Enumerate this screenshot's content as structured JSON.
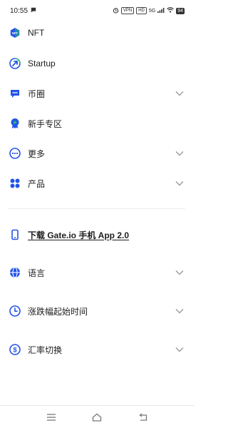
{
  "status_bar": {
    "time": "10:55",
    "badge1": "VPN",
    "badge2": "HD",
    "network": "5G",
    "battery": "94"
  },
  "menu": {
    "items": [
      {
        "id": "nft",
        "label": "NFT",
        "icon": "nft-icon",
        "expandable": false
      },
      {
        "id": "startup",
        "label": "Startup",
        "icon": "startup-arrow-icon",
        "expandable": false
      },
      {
        "id": "bi-quan",
        "label": "币圈",
        "icon": "chat-bubble-icon",
        "expandable": true
      },
      {
        "id": "novice",
        "label": "新手专区",
        "icon": "badge-star-icon",
        "expandable": false
      },
      {
        "id": "more",
        "label": "更多",
        "icon": "more-dots-icon",
        "expandable": true
      },
      {
        "id": "products",
        "label": "产品",
        "icon": "grid-dots-icon",
        "expandable": true
      }
    ],
    "download": {
      "label": "下载 Gate.io 手机 App 2.0",
      "icon": "phone-icon"
    },
    "settings": [
      {
        "id": "language",
        "label": "语言",
        "icon": "globe-icon",
        "expandable": true
      },
      {
        "id": "change-time",
        "label": "涨跌幅起始时间",
        "icon": "clock-icon",
        "expandable": true
      },
      {
        "id": "currency",
        "label": "汇率切换",
        "icon": "currency-icon",
        "expandable": true
      }
    ]
  },
  "colors": {
    "accent": "#2354e6",
    "text": "#1d1d1f",
    "chevron": "#9a9aa0",
    "green": "#2bb673"
  }
}
